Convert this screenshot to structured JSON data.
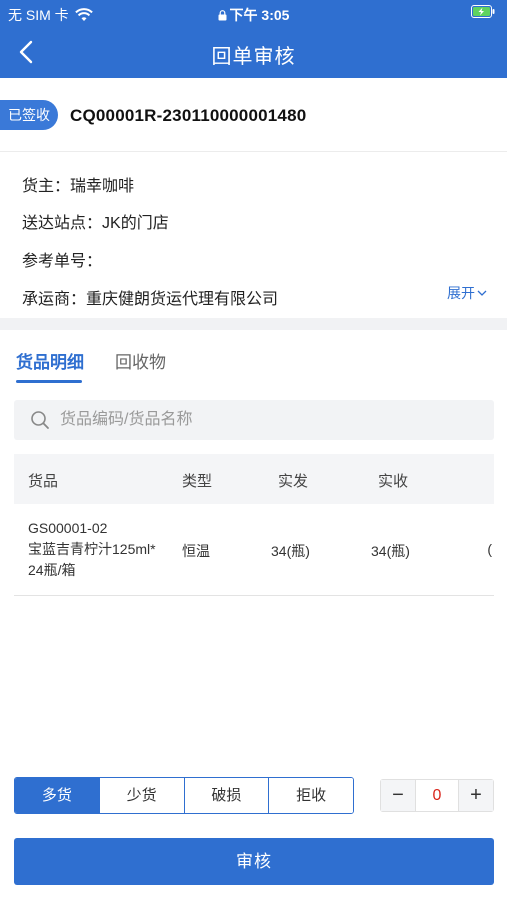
{
  "status_bar": {
    "carrier": "无 SIM 卡",
    "time": "下午 3:05"
  },
  "nav": {
    "title": "回单审核"
  },
  "order": {
    "badge": "已签收",
    "number": "CQ00001R-230110000001480"
  },
  "info": {
    "shipper_label": "货主：",
    "shipper_value": "瑞幸咖啡",
    "station_label": "送达站点：",
    "station_value": "JK的门店",
    "ref_label": "参考单号：",
    "ref_value": "",
    "carrier_label": "承运商：",
    "carrier_value": "重庆健朗货运代理有限公司",
    "expand_label": "展开"
  },
  "tabs": [
    {
      "label": "货品明细",
      "active": true
    },
    {
      "label": "回收物",
      "active": false
    }
  ],
  "search": {
    "placeholder": "货品编码/货品名称"
  },
  "table": {
    "headers": [
      "货品",
      "类型",
      "实发",
      "实收"
    ],
    "rows": [
      {
        "code": "GS00001-02",
        "name_line1": "宝蓝吉青柠汁125ml*",
        "name_line2": "24瓶/箱",
        "type": "恒温",
        "shipped": "34(瓶)",
        "received": "34(瓶)",
        "overflow": "("
      }
    ]
  },
  "segments": [
    {
      "label": "多货",
      "active": true
    },
    {
      "label": "少货",
      "active": false
    },
    {
      "label": "破损",
      "active": false
    },
    {
      "label": "拒收",
      "active": false
    }
  ],
  "stepper": {
    "minus": "−",
    "value": "0",
    "plus": "+"
  },
  "submit_label": "审核",
  "colors": {
    "primary": "#2f6fd0",
    "danger": "#d9261c",
    "background": "#f1f2f4"
  }
}
